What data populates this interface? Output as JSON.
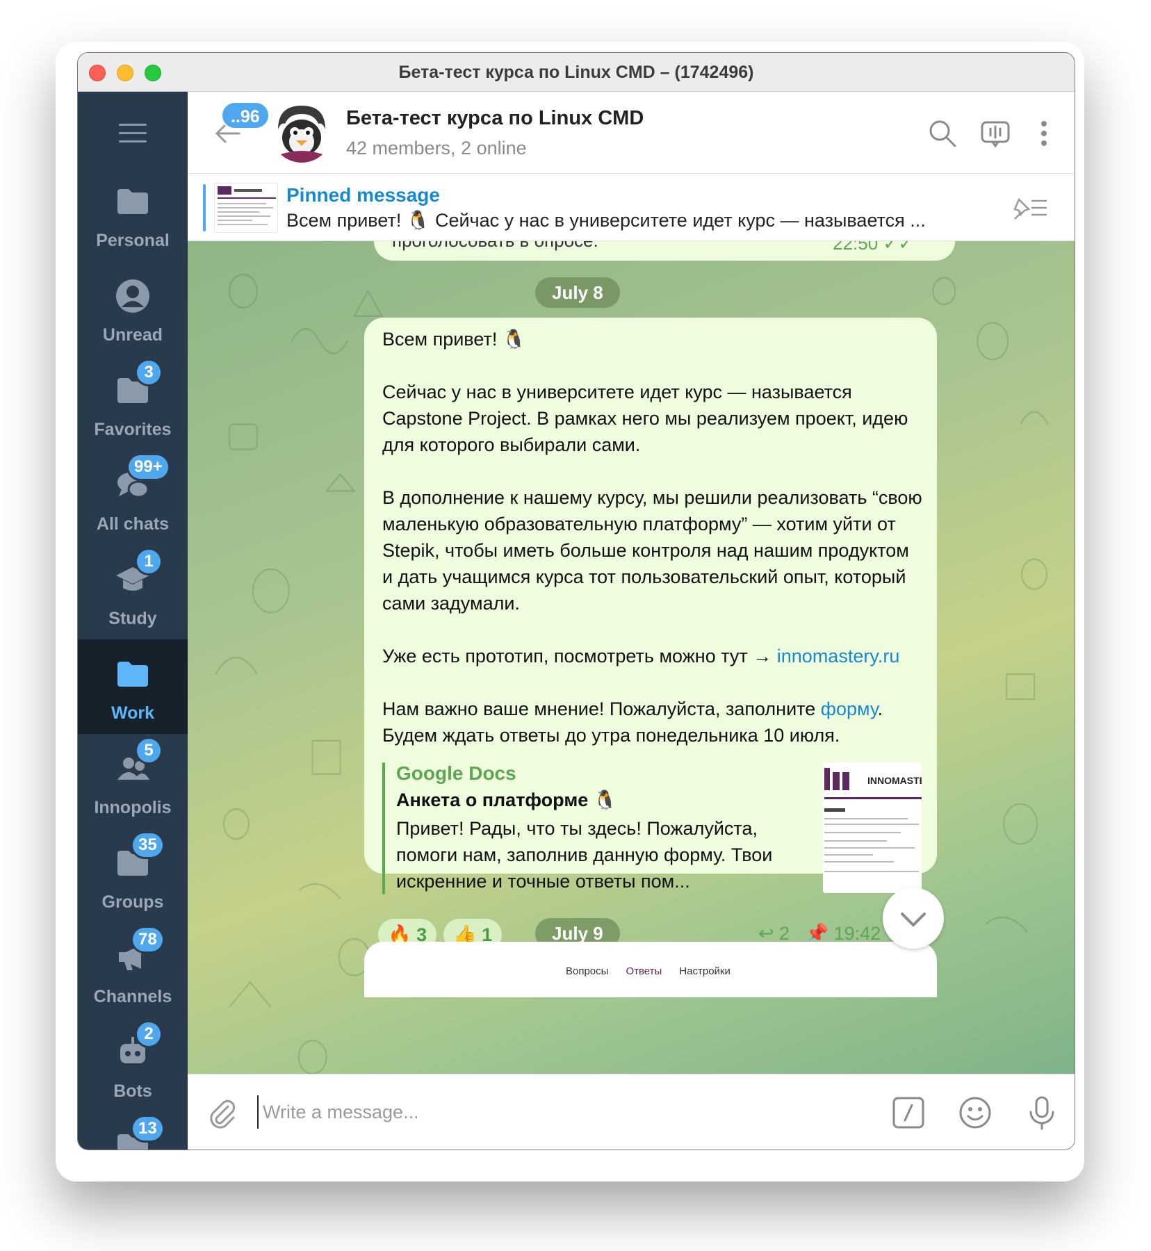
{
  "window": {
    "title": "Бета-тест курса по Linux CMD – (1742496)"
  },
  "sidebar": {
    "folders": [
      {
        "label": "Personal",
        "badge": "",
        "icon": "folder-icon"
      },
      {
        "label": "Unread",
        "badge": "",
        "icon": "person-icon"
      },
      {
        "label": "Favorites",
        "badge": "3",
        "icon": "folder-icon"
      },
      {
        "label": "All chats",
        "badge": "99+",
        "icon": "chats-icon"
      },
      {
        "label": "Study",
        "badge": "1",
        "icon": "graduation-cap-icon"
      },
      {
        "label": "Work",
        "badge": "",
        "icon": "folder-icon",
        "active": true
      },
      {
        "label": "Innopolis",
        "badge": "5",
        "icon": "group-icon"
      },
      {
        "label": "Groups",
        "badge": "35",
        "icon": "folder-icon"
      },
      {
        "label": "Channels",
        "badge": "78",
        "icon": "megaphone-icon"
      },
      {
        "label": "Bots",
        "badge": "2",
        "icon": "robot-icon"
      },
      {
        "label": "",
        "badge": "13",
        "icon": "folder-icon"
      }
    ]
  },
  "header": {
    "back_badge": "..96",
    "chat_name": "Бета-тест курса по Linux CMD",
    "chat_subtitle": "42 members, 2 online"
  },
  "pinned": {
    "title": "Pinned message",
    "text": "Всем привет! 🐧 Сейчас у нас в университете идет курс — называется ..."
  },
  "chat": {
    "prev_message_clip": "проголосовать в опросе.",
    "prev_message_time": "22:50",
    "date1": "July 8",
    "date2": "July 9",
    "message": {
      "p1": "Всем привет! 🐧",
      "p2": "Сейчас у нас в университете идет курс — называется Capstone Project. В рамках него мы реализуем проект, идею для которого выбирали сами.",
      "p3": "В дополнение к нашему курсу, мы решили реализовать “свою маленькую образовательную платформу” — хотим уйти от Stepik, чтобы иметь больше контроля над нашим продуктом и дать учащимся курса тот пользовательский опыт, который сами задумали.",
      "p4_prefix": "Уже есть прототип, посмотреть можно тут → ",
      "p4_link": "innomastery.ru",
      "p5_prefix": "Нам важно ваше мнение! Пожалуйста, заполните ",
      "p5_link": "форму",
      "p5_suffix": ". Будем ждать ответы до утра понедельника 10 июля.",
      "preview": {
        "site": "Google Docs",
        "title": "Анкета о платформе 🐧",
        "description": "Привет! Рады, что ты здесь! Пожалуйста, помоги нам, заполнив данную форму. Твои искренние и точные ответы пом...",
        "thumb_brand": "INNOMASTERY"
      },
      "reactions": [
        {
          "emoji": "🔥",
          "count": "3"
        },
        {
          "emoji": "👍",
          "count": "1"
        }
      ],
      "replies": "2",
      "time": "19:42"
    },
    "next_message_tabs": [
      "Вопросы",
      "Ответы",
      "Настройки"
    ]
  },
  "composer": {
    "placeholder": "Write a message..."
  },
  "colors": {
    "sidebar_bg": "#293a4c",
    "accent": "#4fa7ee",
    "bubble_out": "#effdde",
    "link": "#168acd",
    "green": "#5ea752"
  }
}
